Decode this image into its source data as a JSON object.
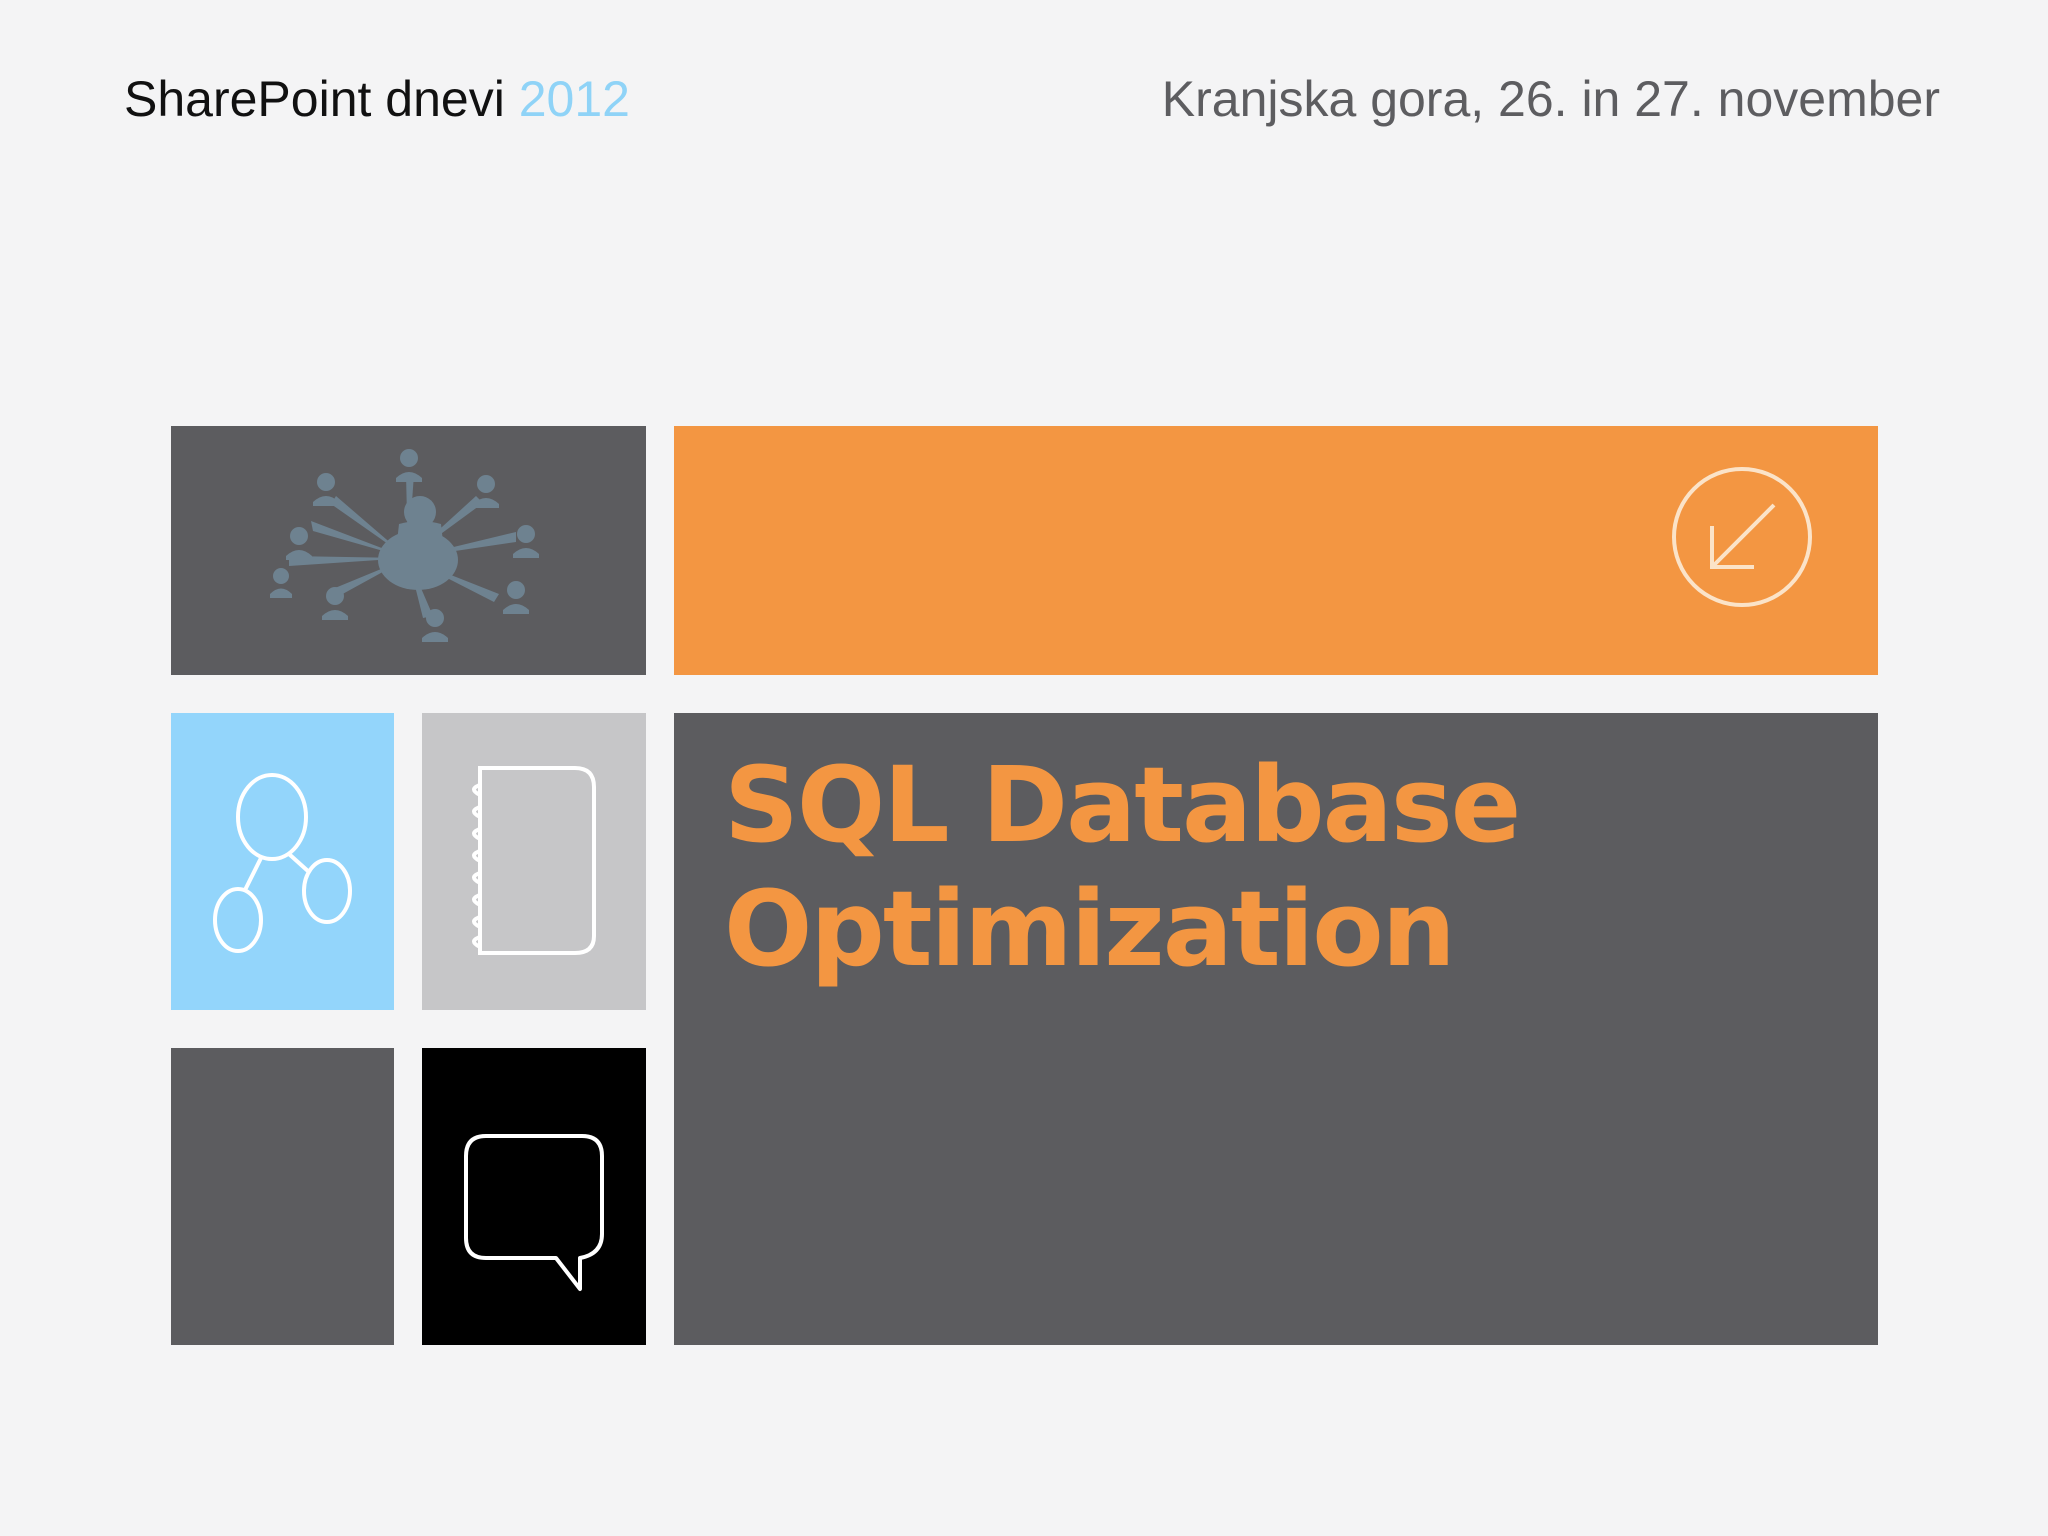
{
  "header": {
    "event_name": "SharePoint dnevi",
    "event_year": "2012",
    "location_date": "Kranjska gora, 26. in 27. november"
  },
  "title": {
    "line1": "SQL Database",
    "line2": "Optimization"
  },
  "icons": {
    "network": "people-network-icon",
    "arrow": "arrow-down-left-circle-icon",
    "nodes": "connected-nodes-icon",
    "notebook": "spiral-notebook-icon",
    "chat": "speech-bubble-icon"
  },
  "colors": {
    "background": "#f4f4f5",
    "orange": "#f39642",
    "dark_gray": "#5c5c5f",
    "light_blue": "#93d5fb",
    "light_gray": "#c6c6c8",
    "black": "#000000",
    "year_blue": "#8fd3f7"
  }
}
